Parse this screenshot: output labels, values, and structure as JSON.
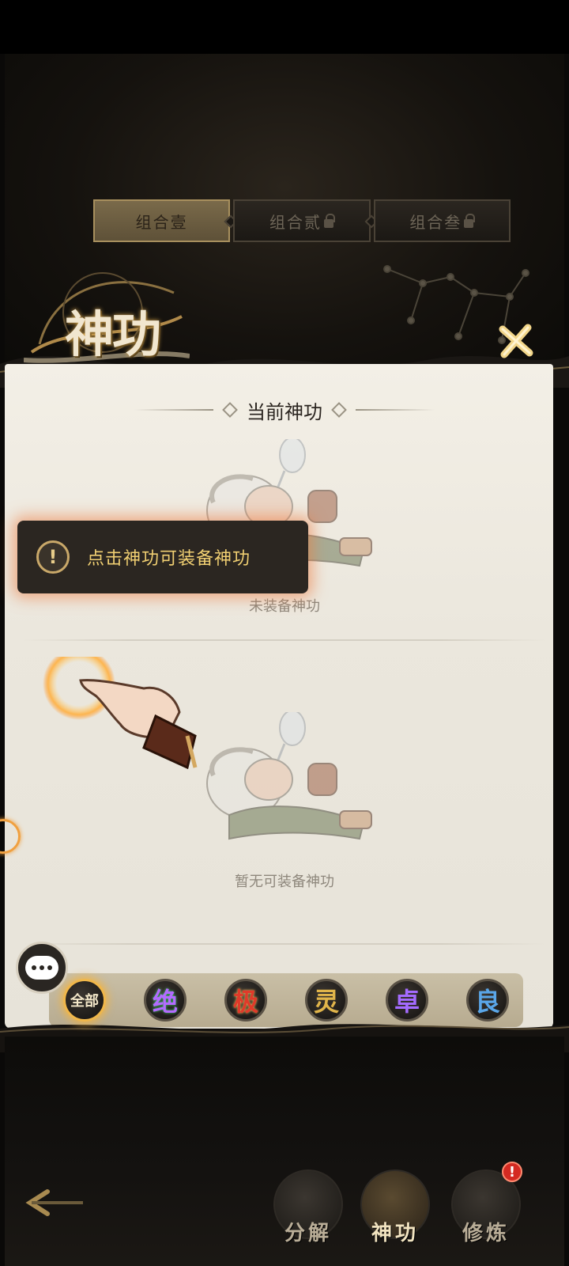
{
  "combo_tabs": [
    {
      "label": "组合壹",
      "active": true,
      "locked": false
    },
    {
      "label": "组合贰",
      "active": false,
      "locked": true
    },
    {
      "label": "组合叁",
      "active": false,
      "locked": true
    }
  ],
  "page_title": "神功",
  "current_section": {
    "title": "当前神功",
    "empty_text": "未装备神功"
  },
  "tooltip": {
    "icon": "!",
    "text": "点击神功可装备神功"
  },
  "list_section": {
    "empty_text": "暂无可装备神功"
  },
  "filters": [
    {
      "label": "全部",
      "selected": true
    },
    {
      "label": "绝",
      "selected": false
    },
    {
      "label": "极",
      "selected": false
    },
    {
      "label": "灵",
      "selected": false
    },
    {
      "label": "卓",
      "selected": false
    },
    {
      "label": "良",
      "selected": false
    }
  ],
  "bottom_nav": [
    {
      "label": "分解",
      "active": false
    },
    {
      "label": "神功",
      "active": true
    },
    {
      "label": "修炼",
      "active": false,
      "badge": "!"
    }
  ],
  "colors": {
    "accent_gold": "#f0b74a",
    "tooltip_text": "#f0cf72",
    "badge_red": "#d42a22"
  }
}
